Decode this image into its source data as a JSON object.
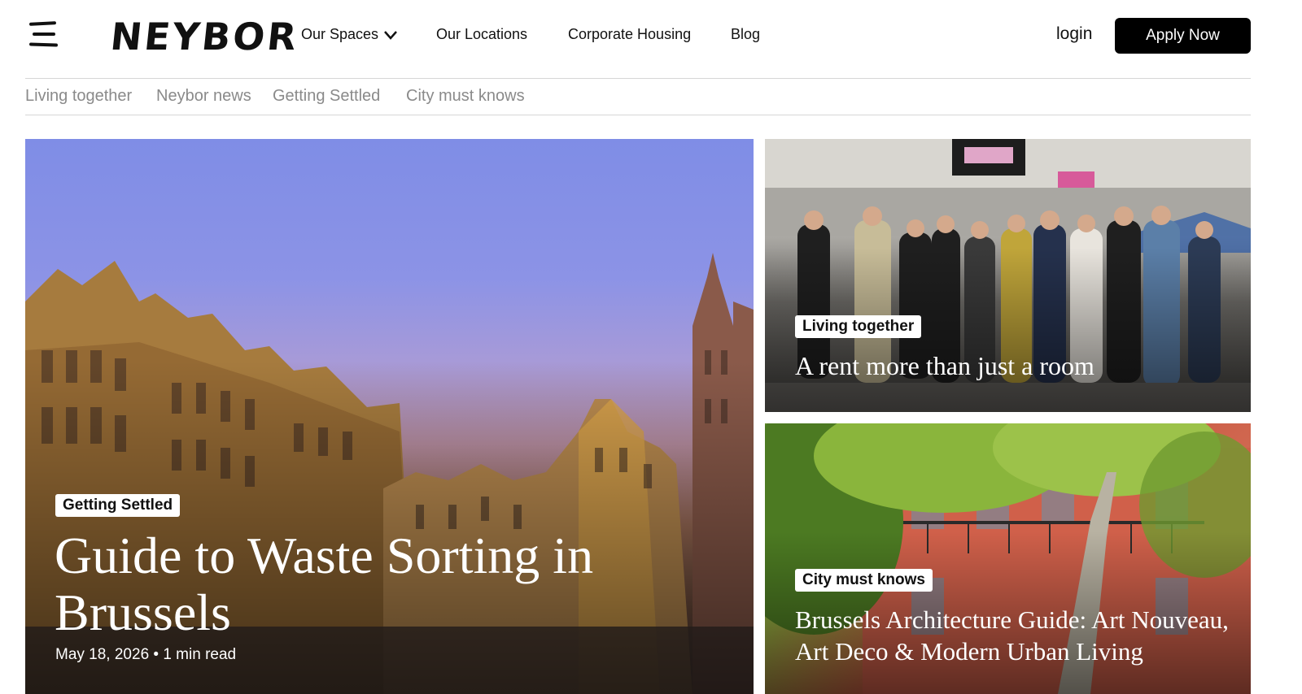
{
  "header": {
    "logo_text": "NEYBOR",
    "nav": [
      {
        "label": "Our Spaces",
        "has_dropdown": true
      },
      {
        "label": "Our Locations"
      },
      {
        "label": "Corporate Housing"
      },
      {
        "label": "Blog"
      }
    ],
    "login_label": "login",
    "apply_label": "Apply Now"
  },
  "subnav": {
    "items": [
      "Living together",
      "Neybor news",
      "Getting Settled",
      "City must knows"
    ]
  },
  "articles": {
    "main": {
      "tag": "Getting Settled",
      "title": "Guide to Waste Sorting in Brussels",
      "meta": "May 18, 2026 • 1 min read"
    },
    "top_right": {
      "tag": "Living together",
      "title": "A rent more than just a room"
    },
    "bottom_right": {
      "tag": "City must knows",
      "title": "Brussels Architecture Guide: Art Nouveau, Art Deco & Modern Urban Living"
    }
  },
  "colors": {
    "apply_button_bg": "#000000",
    "subnav_text": "#8a8a8a"
  },
  "icons": [
    "hamburger-menu-icon",
    "chevron-down-icon"
  ]
}
